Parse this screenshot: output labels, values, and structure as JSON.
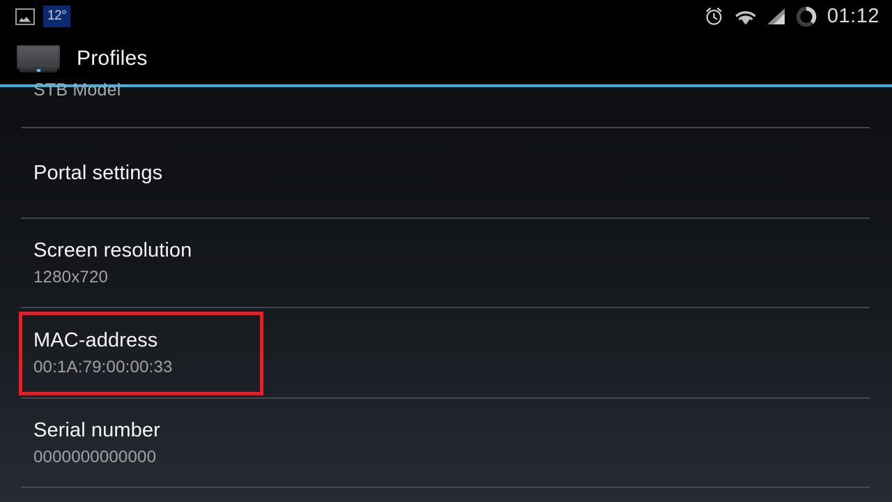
{
  "status_bar": {
    "photo_icon": "photo-icon",
    "weather_temp": "12°",
    "alarm_icon": "alarm-clock-icon",
    "wifi_icon": "wifi-icon",
    "signal_icon": "cellular-signal-icon",
    "battery_icon": "battery-ring-icon",
    "time": "01:12"
  },
  "action_bar": {
    "icon": "tv-icon",
    "title": "Profiles"
  },
  "colors": {
    "accent": "#33b5e5",
    "annotation": "#ee1c25",
    "background": "#14171b",
    "primary_text": "#f4f4f4",
    "secondary_text": "#a0a2a5"
  },
  "list": {
    "items": [
      {
        "title": "STB Model",
        "value": "",
        "clipped": true
      },
      {
        "title": "Portal settings",
        "value": ""
      },
      {
        "title": "Screen resolution",
        "value": "1280x720"
      },
      {
        "title": "MAC-address",
        "value": "00:1A:79:00:00:33",
        "highlighted": true
      },
      {
        "title": "Serial number",
        "value": "0000000000000"
      }
    ]
  }
}
